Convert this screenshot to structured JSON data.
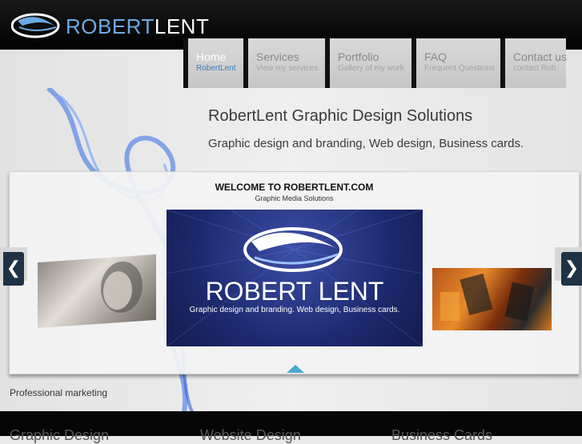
{
  "brand": {
    "name_part1": "ROBERT",
    "name_part2": "LENT"
  },
  "nav": [
    {
      "title": "Home",
      "subtitle": "RobertLent",
      "active": true
    },
    {
      "title": "Services",
      "subtitle": "View my services",
      "active": false
    },
    {
      "title": "Portfolio",
      "subtitle": "Gallery of my work",
      "active": false
    },
    {
      "title": "FAQ",
      "subtitle": "Frequent Questions",
      "active": false
    },
    {
      "title": "Contact us",
      "subtitle": "contact Rob",
      "active": false
    }
  ],
  "hero": {
    "title": "RobertLent Graphic Design Solutions",
    "subtitle": "Graphic design and branding, Web design, Business cards."
  },
  "slider": {
    "heading": "WELCOME TO ROBERTLENT.COM",
    "subheading": "Graphic Media Solutions",
    "main_slide": {
      "name": "ROBERT LENT",
      "tagline": "Graphic design and branding. Web design, Business cards."
    },
    "prev_label": "❮",
    "next_label": "❯"
  },
  "section_label": "Professional marketing",
  "footer": {
    "col1": "Graphic Design",
    "col2": "Website Design",
    "col3": "Business Cards"
  },
  "colors": {
    "accent": "#3b7fc4",
    "header_bg": "#000000",
    "slide_bg": "#1c2a6e"
  }
}
